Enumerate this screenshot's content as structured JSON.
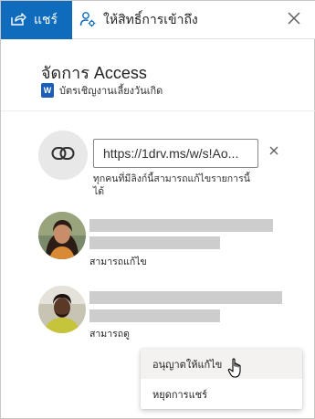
{
  "header": {
    "share_tab_label": "แชร์",
    "access_tab_label": "ให้สิทธิ์การเข้าถึง",
    "accent_color": "#0f6cbd"
  },
  "manage": {
    "title": "จัดการ Access",
    "file_name": "บัตรเชิญงานเลี้ยงวันเกิด",
    "file_icon": "word-doc-icon"
  },
  "link": {
    "url": "https://1drv.ms/w/s!Ao...",
    "description": "ทุกคนที่มีลิงก์นี้สามารถแก้ไขรายการนี้ได้"
  },
  "people": [
    {
      "permission": "สามารถแก้ไข"
    },
    {
      "permission": "สามารถดู"
    }
  ],
  "menu": {
    "items": [
      {
        "label": "อนุญาตให้แก้ไข"
      },
      {
        "label": "หยุดการแชร์"
      }
    ]
  }
}
